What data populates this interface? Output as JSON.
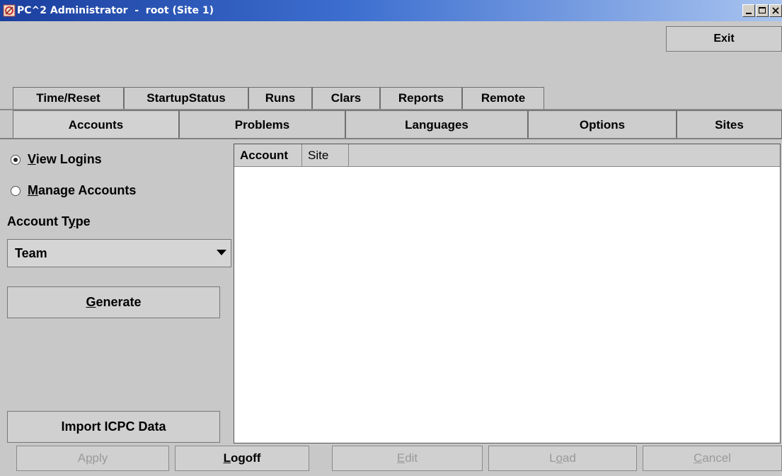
{
  "window": {
    "title": "PC^2 Administrator  -  root (Site 1)",
    "controls": [
      "minimize",
      "maximize",
      "close"
    ]
  },
  "toolbar": {
    "exit_label": "Exit"
  },
  "tabs": {
    "row1": [
      {
        "label": "Time/Reset"
      },
      {
        "label": "StartupStatus"
      },
      {
        "label": "Runs"
      },
      {
        "label": "Clars"
      },
      {
        "label": "Reports"
      },
      {
        "label": "Remote"
      }
    ],
    "row2": [
      {
        "label": "Accounts",
        "selected": true
      },
      {
        "label": "Problems"
      },
      {
        "label": "Languages"
      },
      {
        "label": "Options"
      },
      {
        "label": "Sites"
      }
    ]
  },
  "left_panel": {
    "view_logins_label": "View Logins",
    "view_logins_selected": true,
    "manage_accounts_label": "Manage Accounts",
    "account_type_label": "Account Type",
    "account_type_value": "Team",
    "generate_label": "Generate",
    "import_label": "Import ICPC Data"
  },
  "table": {
    "columns": [
      "Account",
      "Site",
      ""
    ],
    "rows": []
  },
  "bottom_buttons": [
    {
      "label": "Apply",
      "enabled": false
    },
    {
      "label": "Logoff",
      "enabled": true
    },
    {
      "label": "Edit",
      "enabled": false
    },
    {
      "label": "Load",
      "enabled": false
    },
    {
      "label": "Cancel",
      "enabled": false
    }
  ]
}
